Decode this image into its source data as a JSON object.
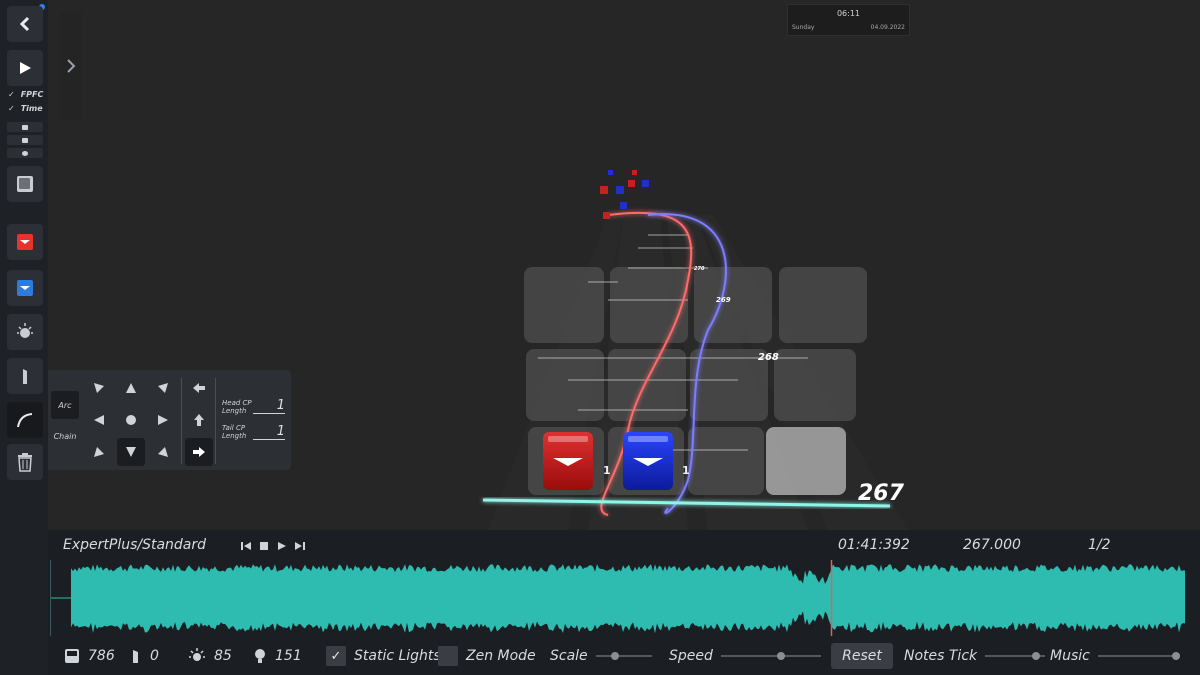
{
  "toolbar": {
    "back_icon": "chevron-left-icon",
    "play_icon": "play-icon",
    "fpfc_label": "FPFC",
    "time_label": "Time",
    "items": [
      "note-icon",
      "red-note-icon",
      "blue-note-icon",
      "light-icon",
      "obstacle-icon",
      "arc-icon",
      "trash-icon"
    ],
    "colors": {
      "red": "#e8332c",
      "blue": "#2c7bde"
    }
  },
  "clock": {
    "time": "06:11",
    "day": "Sunday",
    "date": "04.09.2022"
  },
  "viewport": {
    "beat_labels": [
      "267",
      "268",
      "269",
      "270"
    ],
    "note_labels": [
      "1",
      "1"
    ],
    "note_colors": {
      "red": "#c81818",
      "blue": "#1a2fd0"
    }
  },
  "placement": {
    "arc_label": "Arc",
    "chain_label": "Chain",
    "head_cp_label": "Head CP Length",
    "head_cp_value": "1",
    "tail_cp_label": "Tail CP Length",
    "tail_cp_value": "1"
  },
  "timeline": {
    "difficulty": "ExpertPlus/Standard",
    "time": "01:41:392",
    "beat": "267.000",
    "precision": "1/2",
    "waveform_color": "#2fbcb0",
    "playhead_position": 0.67
  },
  "status": {
    "notes_count": "786",
    "obstacles_count": "0",
    "events_count": "85",
    "bpm_count": "151",
    "static_lights_label": "Static Lights",
    "static_lights_checked": "✓",
    "zen_mode_label": "Zen Mode",
    "scale_label": "Scale",
    "speed_label": "Speed",
    "reset_label": "Reset",
    "notes_tick_label": "Notes Tick",
    "music_label": "Music",
    "scale_level": 0.35,
    "speed_level": 0.6,
    "notes_tick_level": 0.85,
    "music_level": 0.95
  }
}
